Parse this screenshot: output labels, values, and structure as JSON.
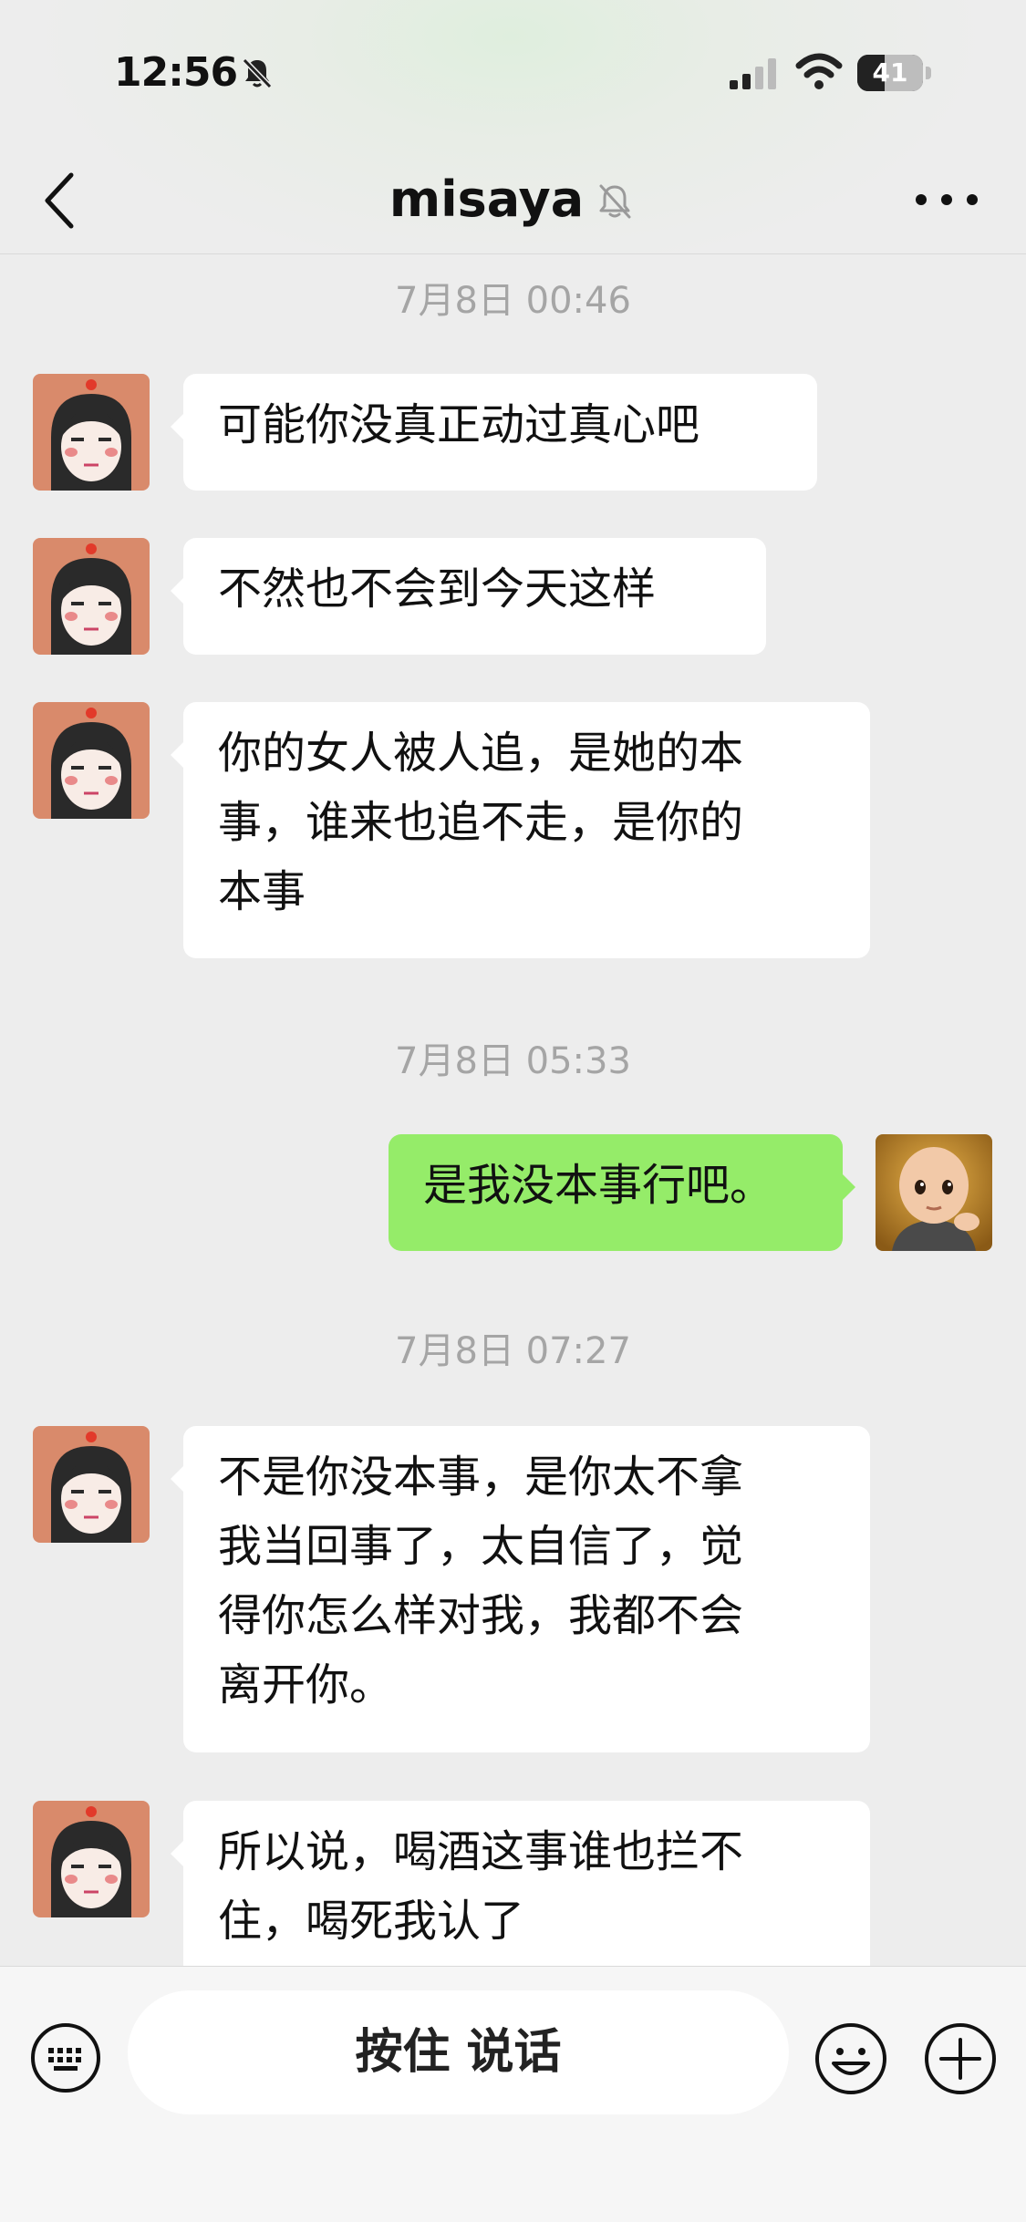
{
  "status_bar": {
    "time": "12:56",
    "battery": "41",
    "battery_level": 0.41
  },
  "nav": {
    "title": "misaya"
  },
  "messages": [
    {
      "timestamp": "7月8日 00:46"
    },
    {
      "side": "left",
      "text": "可能你没真正动过真心吧"
    },
    {
      "side": "left",
      "text": "不然也不会到今天这样"
    },
    {
      "side": "left",
      "lines": [
        "你的女人被人追，是她的本",
        "事，谁来也追不走，是你的",
        "本事"
      ]
    },
    {
      "timestamp": "7月8日 05:33"
    },
    {
      "side": "right",
      "text": "是我没本事行吧。"
    },
    {
      "timestamp": "7月8日 07:27"
    },
    {
      "side": "left",
      "lines": [
        "不是你没本事，是你太不拿",
        "我当回事了，太自信了，觉",
        "得你怎么样对我，我都不会",
        "离开你。"
      ]
    },
    {
      "side": "left",
      "lines": [
        "所以说，喝酒这事谁也拦不",
        "住，喝死我认了"
      ]
    }
  ],
  "input_bar": {
    "talk_label": "按住 说话"
  },
  "icons": {
    "back": "chevron-left-icon",
    "mute": "bell-off-icon",
    "more": "more-dots-icon",
    "keyboard": "keyboard-icon",
    "emoji": "emoji-icon",
    "plus": "plus-icon"
  },
  "colors": {
    "outgoing_bubble": "#95ec69",
    "incoming_bubble": "#ffffff",
    "background": "#ededed"
  }
}
